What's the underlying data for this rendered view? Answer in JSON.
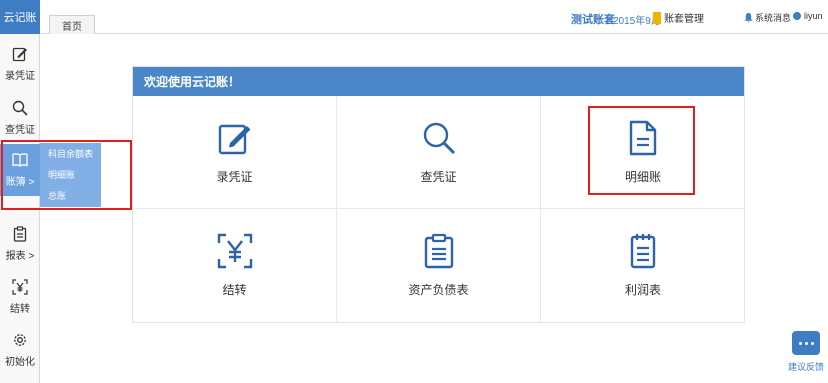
{
  "app": {
    "logo": "云记账"
  },
  "tabs": [
    {
      "label": "首页"
    }
  ],
  "header": {
    "account_name": "测试账套",
    "period": "2015年9月",
    "set_book": "账套管理",
    "system_msg": "系统消息",
    "user": "liyun"
  },
  "sidebar": {
    "items": [
      {
        "label": "录凭证",
        "icon": "edit-icon"
      },
      {
        "label": "查凭证",
        "icon": "search-icon"
      },
      {
        "label": "账簿 >",
        "icon": "book-icon"
      },
      {
        "label": "报表 >",
        "icon": "clipboard-icon"
      },
      {
        "label": "结转",
        "icon": "yen-icon"
      },
      {
        "label": "初始化",
        "icon": "gear-icon"
      }
    ],
    "submenu": [
      "科目余额表",
      "明细账",
      "总账"
    ]
  },
  "panel": {
    "title": "欢迎使用云记账！",
    "tiles": [
      {
        "label": "录凭证",
        "icon": "edit-icon"
      },
      {
        "label": "查凭证",
        "icon": "search-icon"
      },
      {
        "label": "明细账",
        "icon": "document-icon"
      },
      {
        "label": "结转",
        "icon": "yen-icon"
      },
      {
        "label": "资产负债表",
        "icon": "clipboard-icon"
      },
      {
        "label": "利润表",
        "icon": "notebook-icon"
      }
    ]
  },
  "feedback": {
    "label": "建议反馈"
  },
  "colors": {
    "primary": "#3e7cc4",
    "header_bar": "#4a86c8",
    "highlight": "#e0201e",
    "active_side": "#6aa0de"
  }
}
